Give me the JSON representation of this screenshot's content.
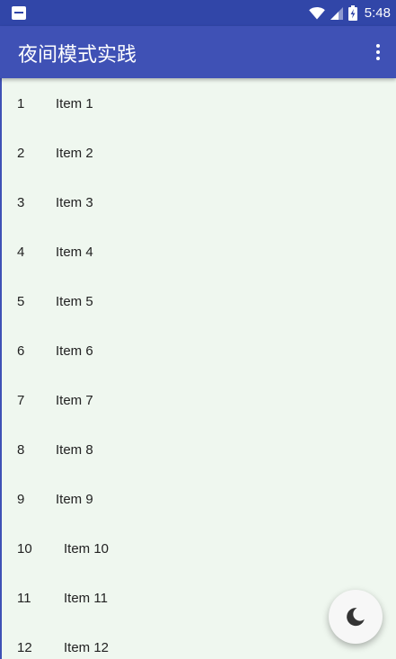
{
  "status_bar": {
    "time": "5:48",
    "icons": [
      "notification-icon",
      "wifi-icon",
      "cell-signal-icon",
      "battery-charging-icon"
    ]
  },
  "toolbar": {
    "title": "夜间模式实践",
    "menu_icon": "more-vert-icon"
  },
  "list": {
    "items": [
      {
        "number": "1",
        "label": "Item 1"
      },
      {
        "number": "2",
        "label": "Item 2"
      },
      {
        "number": "3",
        "label": "Item 3"
      },
      {
        "number": "4",
        "label": "Item 4"
      },
      {
        "number": "5",
        "label": "Item 5"
      },
      {
        "number": "6",
        "label": "Item 6"
      },
      {
        "number": "7",
        "label": "Item 7"
      },
      {
        "number": "8",
        "label": "Item 8"
      },
      {
        "number": "9",
        "label": "Item 9"
      },
      {
        "number": "10",
        "label": "Item 10"
      },
      {
        "number": "11",
        "label": "Item 11"
      },
      {
        "number": "12",
        "label": "Item 12"
      }
    ]
  },
  "fab": {
    "icon": "moon-icon"
  },
  "colors": {
    "status_bar": "#3146a8",
    "toolbar": "#3f51b5",
    "background": "#eff7ef",
    "fab": "#f7f7f7"
  }
}
